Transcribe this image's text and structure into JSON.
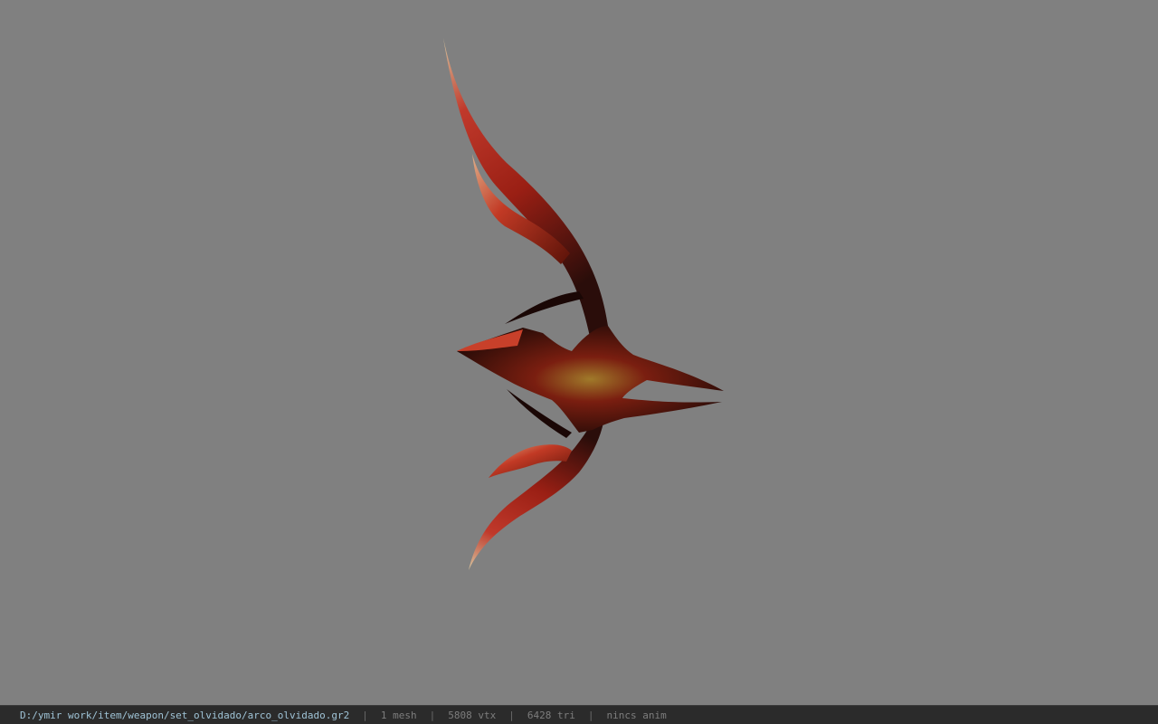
{
  "viewport": {
    "background_color": "#808080",
    "model_icon": "bow-model"
  },
  "statusbar": {
    "file_path": "D:/ymir work/item/weapon/set_olvidado/arco_olvidado.gr2",
    "separator": "|",
    "mesh_count": "1 mesh",
    "vertex_count": "5808 vtx",
    "triangle_count": "6428 tri",
    "anim_status": "nincs anim"
  },
  "colors": {
    "statusbar_bg": "#2b2b2b",
    "path_text": "#9fc3d6",
    "info_text": "#7d7d7d",
    "bow_red": "#b3261e",
    "bow_dark": "#2a0d0a"
  }
}
